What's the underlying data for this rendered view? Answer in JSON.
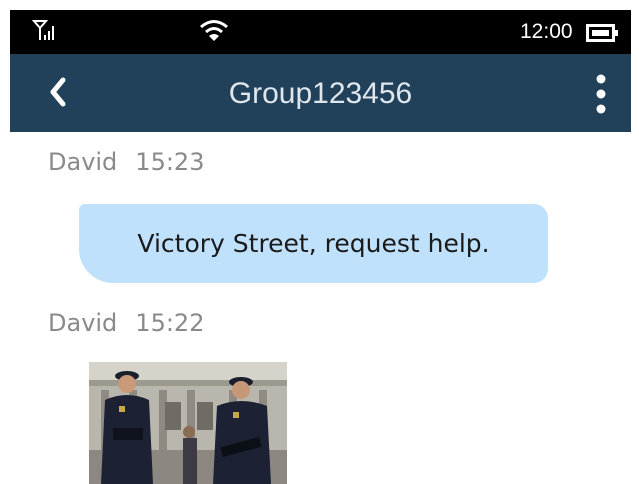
{
  "status_bar": {
    "time": "12:00",
    "icons": [
      "signal-icon",
      "wifi-icon",
      "battery-icon"
    ]
  },
  "header": {
    "title": "Group123456",
    "icons": [
      "back-arrow-icon",
      "more-vertical-icon"
    ]
  },
  "messages": [
    {
      "sender": "David",
      "time": "15:23",
      "type": "text",
      "text": "Victory Street, request help."
    },
    {
      "sender": "David",
      "time": "15:22",
      "type": "image"
    }
  ],
  "colors": {
    "status_bar_bg": "#000000",
    "header_bg": "#21415b",
    "header_text": "#dfe6ec",
    "bubble_bg": "#bfe1fb",
    "meta_text": "#8a8a8a"
  }
}
